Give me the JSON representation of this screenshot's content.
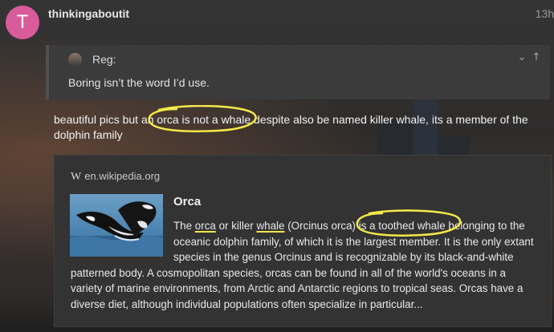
{
  "post": {
    "username": "thinkingaboutit",
    "avatar_letter": "T",
    "avatar_color": "#d85b9a",
    "age": "13h"
  },
  "quote": {
    "author": "Reg:",
    "text": "Boring isn’t the word I’d use.",
    "collapse_icon": "chevron-down-icon",
    "jump_icon": "arrow-up-icon"
  },
  "body_text": {
    "before": "beautiful pics but an ",
    "highlight": "orca is not a whale",
    "after": " despite also be named killer whale, its a member of the dolphin family"
  },
  "onebox": {
    "source": "en.wikipedia.org",
    "source_logo": "W",
    "title": "Orca",
    "excerpt": {
      "p1": "The ",
      "link1": "orca",
      "p2": " or killer ",
      "link2": "whale",
      "p3": " (Orcinus orca) ",
      "highlight": "is a toothed whale",
      "p4": " belonging to the oceanic dolphin family, of which it is the largest member. It is the only extant species in the genus Orcinus and is recognizable by its black-and-white patterned body. A cosmopolitan species, orcas can be found in all of the world's oceans in a variety of marine environments, from Arctic and Antarctic regions to tropical seas. Orcas have a diverse diet, although individual populations often specialize in particular..."
    }
  },
  "colors": {
    "annotation": "#f5e94a",
    "background": "#2a2a2a",
    "onebox_bg": "#333333"
  }
}
